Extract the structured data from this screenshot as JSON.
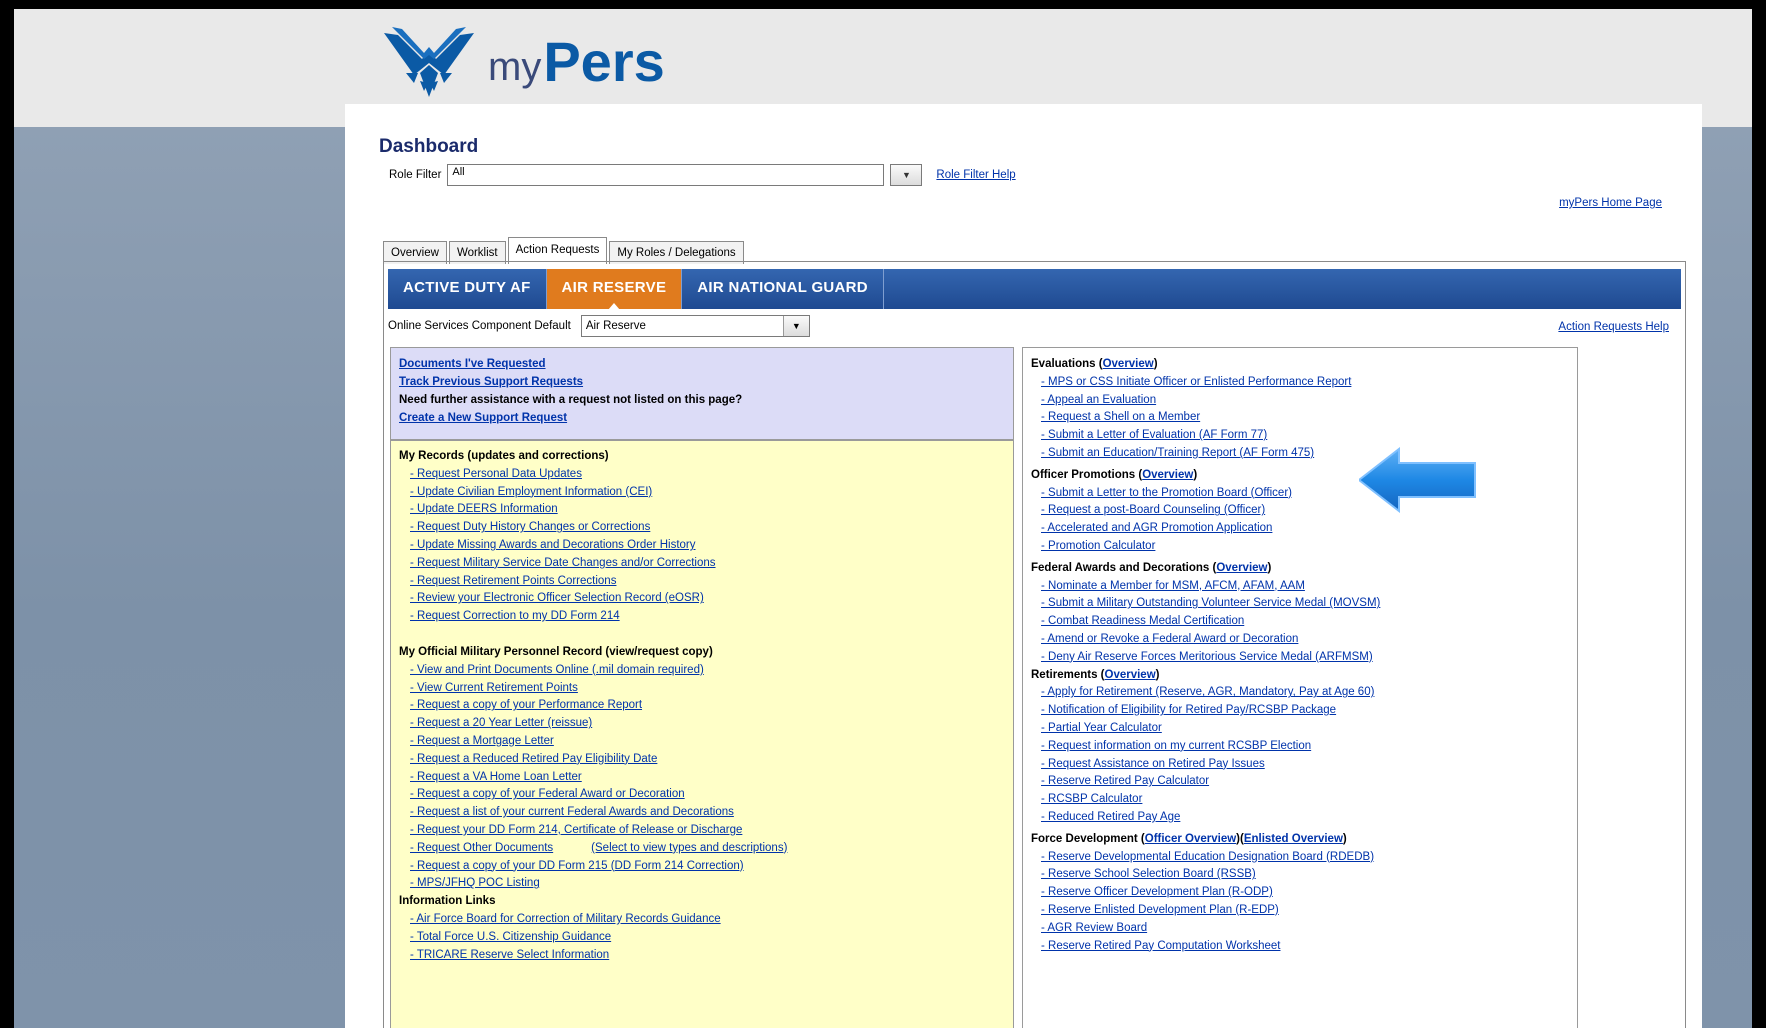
{
  "brand": {
    "my": "my",
    "pers": "Pers",
    "emblem": "air-force-wings-icon"
  },
  "dashboard": {
    "title": "Dashboard",
    "role_filter_label": "Role Filter",
    "role_filter_value": "All",
    "role_filter_help": "Role Filter Help",
    "home_link": "myPers Home Page"
  },
  "tabs": [
    "Overview",
    "Worklist",
    "Action Requests",
    "My Roles / Delegations"
  ],
  "active_tab": "Action Requests",
  "components": [
    "ACTIVE DUTY AF",
    "AIR RESERVE",
    "AIR NATIONAL GUARD"
  ],
  "active_component": "AIR RESERVE",
  "component_default": {
    "label": "Online Services Component Default",
    "value": "Air Reserve"
  },
  "action_requests_help": "Action Requests Help",
  "left_top": {
    "link1": "Documents I've Requested",
    "link2": "Track Previous Support Requests",
    "text": "Need further assistance with a request not listed on this page?",
    "link3": "Create a New Support Request"
  },
  "left": {
    "my_records": {
      "title": "My Records (updates and corrections)",
      "items": [
        "- Request Personal Data Updates",
        "- Update Civilian Employment Information (CEI)",
        "- Update DEERS Information",
        "- Request Duty History Changes or Corrections",
        "- Update Missing Awards and Decorations Order History",
        "- Request Military Service Date Changes and/or Corrections",
        "- Request Retirement Points Corrections",
        "- Review your Electronic Officer Selection Record (eOSR)",
        "- Request Correction to my DD Form 214"
      ]
    },
    "ompr": {
      "title": "My Official Military Personnel Record (view/request copy)",
      "items": [
        "- View and Print Documents Online (.mil domain required)",
        "- View Current Retirement Points",
        "- Request a copy of your Performance Report",
        "- Request a 20 Year Letter (reissue)",
        "- Request a Mortgage Letter",
        "- Request a Reduced Retired Pay Eligibility Date",
        "- Request a VA Home Loan Letter",
        "- Request a copy of your Federal Award or Decoration",
        "- Request a list of your current Federal Awards and Decorations",
        "- Request your DD Form 214, Certificate of Release or Discharge",
        "- Request Other Documents",
        "- Request a copy of your DD Form 215 (DD Form 214 Correction)",
        "- MPS/JFHQ POC Listing"
      ],
      "other_docs_sub": "(Select to view types and descriptions)"
    },
    "info": {
      "title": "Information Links",
      "items": [
        "- Air Force Board for Correction of Military Records Guidance",
        "- Total Force U.S. Citizenship Guidance",
        "- TRICARE Reserve Select Information"
      ]
    }
  },
  "right": {
    "evaluations": {
      "title": "Evaluations (",
      "link": "Overview",
      "close": ")",
      "items": [
        "- MPS or CSS Initiate Officer or Enlisted Performance Report",
        "- Appeal an Evaluation",
        "- Request a Shell on a Member",
        "- Submit a Letter of Evaluation (AF Form 77)",
        "- Submit an Education/Training Report (AF Form 475)"
      ]
    },
    "promotions": {
      "title": "Officer Promotions (",
      "link": "Overview",
      "close": ")",
      "items": [
        "- Submit a Letter to the Promotion Board (Officer)",
        "- Request a post-Board Counseling (Officer)",
        "- Accelerated and AGR Promotion Application",
        "- Promotion Calculator"
      ]
    },
    "awards": {
      "title": "Federal Awards and Decorations (",
      "link": "Overview",
      "close": ")",
      "items": [
        "- Nominate a Member for MSM, AFCM, AFAM, AAM",
        "- Submit a Military Outstanding Volunteer Service Medal (MOVSM)",
        "- Combat Readiness Medal Certification",
        "- Amend or Revoke a Federal Award or Decoration",
        "- Deny Air Reserve Forces Meritorious Service Medal (ARFMSM)"
      ]
    },
    "retirements": {
      "title": "Retirements (",
      "link": "Overview",
      "close": ")",
      "items": [
        "- Apply for Retirement (Reserve, AGR, Mandatory, Pay at Age 60)",
        "- Notification of Eligibility for Retired Pay/RCSBP Package",
        "- Partial Year Calculator",
        "- Request information on my current RCSBP Election",
        "- Request Assistance on Retired Pay Issues",
        "- Reserve Retired Pay Calculator",
        "- RCSBP Calculator",
        "- Reduced Retired Pay Age"
      ]
    },
    "force_dev": {
      "title": "Force Development (",
      "link1": "Officer Overview",
      "mid": ")(",
      "link2": "Enlisted Overview",
      "close": ")",
      "items": [
        "- Reserve Developmental Education Designation Board (RDEDB)",
        "- Reserve School Selection Board (RSSB)",
        "- Reserve Officer Development Plan (R-ODP)",
        "- Reserve Enlisted Development Plan (R-EDP)",
        "- AGR Review Board",
        "- Reserve Retired Pay Computation Worksheet"
      ]
    }
  },
  "colors": {
    "accent_orange": "#e07b1e",
    "bar_blue": "#2b5aa3",
    "link": "#0033aa",
    "yellow_bg": "#ffffc8",
    "lavender_bg": "#dcdcf7",
    "arrow": "#1e88e5"
  }
}
